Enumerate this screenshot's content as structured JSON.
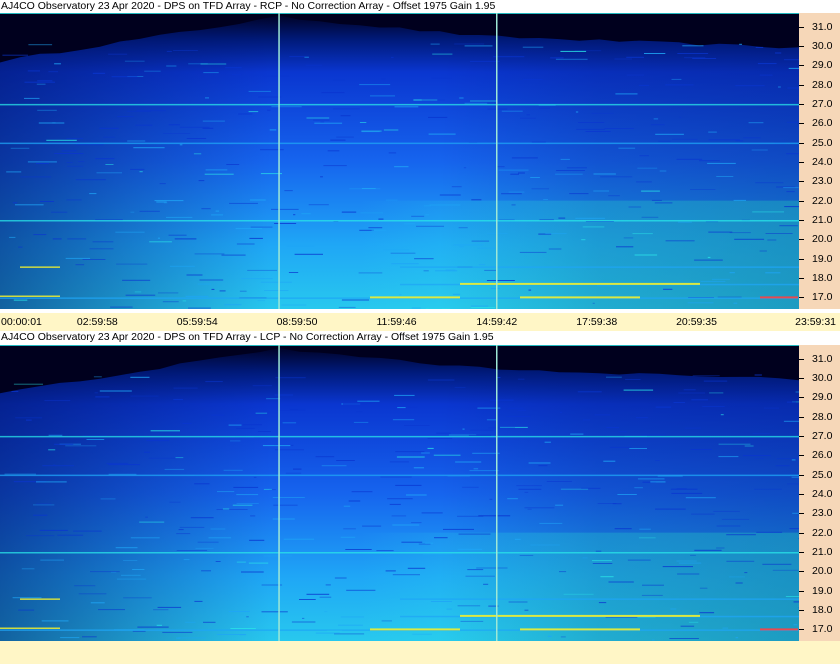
{
  "panels": [
    {
      "title": "AJ4CO Observatory 23 Apr 2020 - DPS on TFD Array  - RCP  -  No Correction Array  -  Offset 1975  Gain 1.95",
      "polarization": "RCP"
    },
    {
      "title": "AJ4CO Observatory 23 Apr 2020 - DPS on TFD Array  - LCP  -  No Correction Array  -  Offset 1975  Gain 1.95",
      "polarization": "LCP"
    }
  ],
  "chart_data": [
    {
      "type": "heatmap",
      "title": "AJ4CO Observatory 23 Apr 2020 - DPS on TFD Array  - RCP  -  No Correction Array  -  Offset 1975  Gain 1.95",
      "xlabel": "",
      "ylabel": "",
      "x_tick_labels": [
        "00:00:01",
        "02:59:58",
        "05:59:54",
        "08:59:50",
        "11:59:46",
        "14:59:42",
        "17:59:38",
        "20:59:35",
        "23:59:31"
      ],
      "y_tick_labels": [
        "31.0",
        "30.0",
        "29.0",
        "28.0",
        "27.0",
        "26.0",
        "25.0",
        "24.0",
        "23.0",
        "22.0",
        "21.0",
        "20.0",
        "19.0",
        "18.0",
        "17.0"
      ],
      "ylim": [
        16.4,
        31.7
      ],
      "colormap": [
        "#00001e",
        "#001a7a",
        "#0a36d0",
        "#1664ee",
        "#1fa6f6",
        "#2ae6e8",
        "#f0f030",
        "#ff4040"
      ],
      "vertical_markers_hours": [
        8.36,
        14.9
      ],
      "interference_lines_mhz": [
        27.0,
        25.0,
        21.0,
        17.0,
        17.7,
        18.6
      ],
      "grid": false
    },
    {
      "type": "heatmap",
      "title": "AJ4CO Observatory 23 Apr 2020 - DPS on TFD Array  - LCP  -  No Correction Array  -  Offset 1975  Gain 1.95",
      "xlabel": "",
      "ylabel": "",
      "y_tick_labels": [
        "31.0",
        "30.0",
        "29.0",
        "28.0",
        "27.0",
        "26.0",
        "25.0",
        "24.0",
        "23.0",
        "22.0",
        "21.0",
        "20.0",
        "19.0",
        "18.0",
        "17.0"
      ],
      "ylim": [
        16.4,
        31.7
      ],
      "colormap": [
        "#00001e",
        "#001a7a",
        "#0a36d0",
        "#1664ee",
        "#1fa6f6",
        "#2ae6e8",
        "#f0f030",
        "#ff4040"
      ],
      "vertical_markers_hours": [
        8.36,
        14.9
      ],
      "interference_lines_mhz": [
        27.0,
        25.0,
        21.0,
        17.0,
        17.7,
        18.6
      ],
      "grid": false
    }
  ]
}
